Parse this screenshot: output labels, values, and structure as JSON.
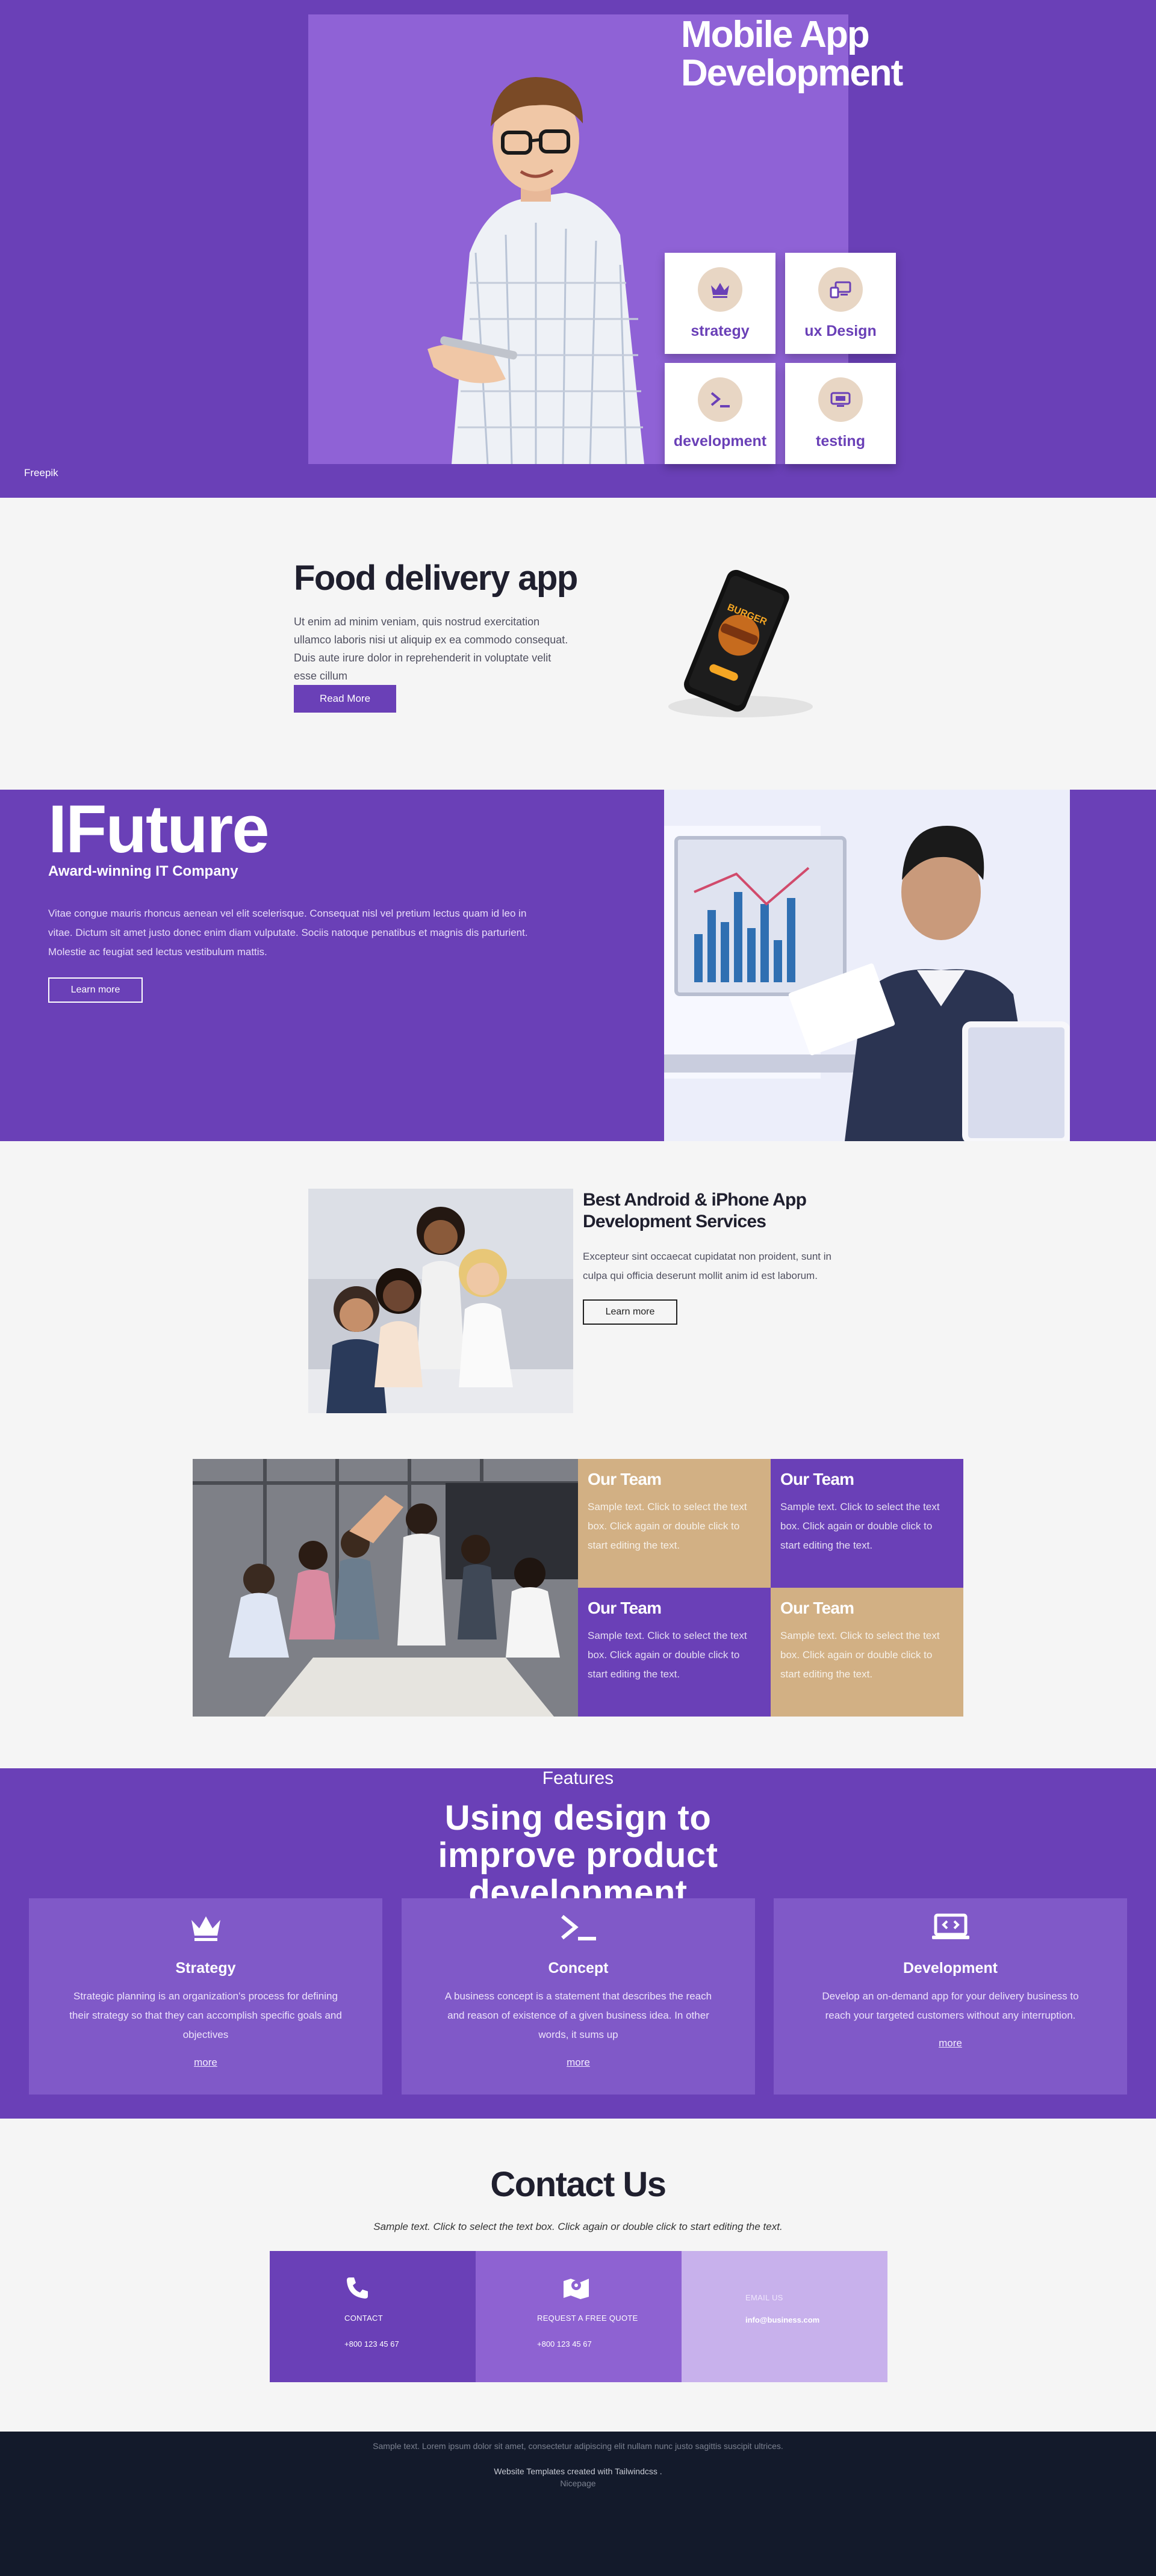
{
  "hero": {
    "title": "Mobile App Development",
    "credit": "Freepik",
    "tiles": [
      {
        "label": "strategy",
        "icon": "crown-icon"
      },
      {
        "label": "ux Design",
        "icon": "devices-icon"
      },
      {
        "label": "development",
        "icon": "terminal-icon"
      },
      {
        "label": "testing",
        "icon": "monitor-icon"
      }
    ]
  },
  "food": {
    "title": "Food delivery app",
    "text": "Ut enim ad minim veniam, quis nostrud exercitation ullamco laboris nisi ut aliquip ex ea commodo consequat. Duis aute irure dolor in reprehenderit in voluptate velit esse cillum",
    "button": "Read More",
    "phone_text": "BURGER"
  },
  "ifuture": {
    "title": "IFuture",
    "subtitle": "Award-winning IT Company",
    "text": "Vitae congue mauris rhoncus aenean vel elit scelerisque. Consequat nisl vel pretium lectus quam id leo in vitae. Dictum sit amet justo donec enim diam vulputate. Sociis natoque penatibus et magnis dis parturient. Molestie ac feugiat sed lectus vestibulum mattis.",
    "button": "Learn more"
  },
  "android": {
    "title": "Best Android & iPhone App Development Services",
    "text": "Excepteur sint occaecat cupidatat non proident, sunt in culpa qui officia deserunt mollit anim id est laborum.",
    "button": "Learn more"
  },
  "team": {
    "cells": [
      {
        "title": "Our Team",
        "text": "Sample text. Click to select the text box. Click again or double click to start editing the text."
      },
      {
        "title": "Our Team",
        "text": "Sample text. Click to select the text box. Click again or double click to start editing the text."
      },
      {
        "title": "Our Team",
        "text": "Sample text. Click to select the text box. Click again or double click to start editing the text."
      },
      {
        "title": "Our Team",
        "text": "Sample text. Click to select the text box. Click again or double click to start editing the text."
      }
    ]
  },
  "features": {
    "eyebrow": "Features",
    "title": "Using design to improve product development",
    "cards": [
      {
        "title": "Strategy",
        "text": "Strategic planning is an organization's process for defining their strategy so that they can accomplish specific goals and objectives",
        "more": "more",
        "icon": "crown-icon"
      },
      {
        "title": "Concept",
        "text": "A business concept is a statement that describes the reach and reason of existence of a given business idea. In other words, it sums up",
        "more": "more",
        "icon": "terminal-icon"
      },
      {
        "title": "Development",
        "text": "Develop an on-demand app for your delivery business to reach your targeted customers without any interruption.",
        "more": "more",
        "icon": "laptop-code-icon"
      }
    ]
  },
  "contact": {
    "title": "Contact Us",
    "note": "Sample text. Click to select the text box. Click again or double click to start editing the text.",
    "boxes": [
      {
        "label": "CONTACT",
        "value": "+800 123 45 67",
        "icon": "phone-icon"
      },
      {
        "label": "REQUEST A FREE QUOTE",
        "value": "+800 123 45 67",
        "icon": "map-pin-icon"
      },
      {
        "label": "EMAIL US",
        "value": "info@business.com",
        "icon": ""
      }
    ]
  },
  "footer": {
    "text": "Sample text. Lorem ipsum dolor sit amet, consectetur adipiscing elit nullam nunc justo sagittis suscipit ultrices.",
    "credit": "Website Templates created with Tailwindcss .",
    "link": "Nicepage"
  },
  "colors": {
    "primary": "#6a40b7",
    "tan": "#d2b084",
    "light_purple": "#8f62d6",
    "footer": "#131a2b"
  }
}
